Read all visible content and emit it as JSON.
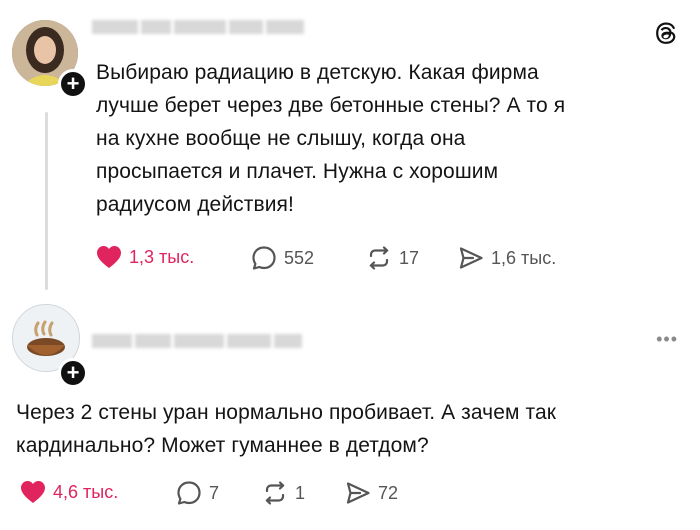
{
  "app": {
    "logo_icon": "threads-logo-icon",
    "accent_like": "#e0245e"
  },
  "posts": [
    {
      "author_blurred": true,
      "text": "Выбираю радиацию в детскую. Какая фирма лучше берет через две бетонные стены? А то я на кухне вообще не слышу, когда она просыпается и плачет. Нужна с хорошим радиусом действия!",
      "lines": [
        "Выбираю радиацию в детскую. Какая фирма",
        "лучше берет через две бетонные стены? А то я",
        "на кухне вообще не слышу, когда она",
        "просыпается и плачет. Нужна с хорошим",
        "радиусом действия!"
      ],
      "likes": "1,3 тыс.",
      "replies": "552",
      "reposts": "17",
      "shares": "1,6 тыс."
    },
    {
      "author_blurred": true,
      "lines": [
        "Через 2 стены уран нормально пробивает. А зачем так",
        "кардинально? Может гуманнее в детдом?"
      ],
      "likes": "4,6 тыс.",
      "replies": "7",
      "reposts": "1",
      "shares": "72"
    }
  ],
  "icons": {
    "like": "heart-icon",
    "reply": "speech-bubble-icon",
    "repost": "repost-icon",
    "share": "send-icon",
    "follow": "plus-icon",
    "more": "more-dots-icon"
  }
}
